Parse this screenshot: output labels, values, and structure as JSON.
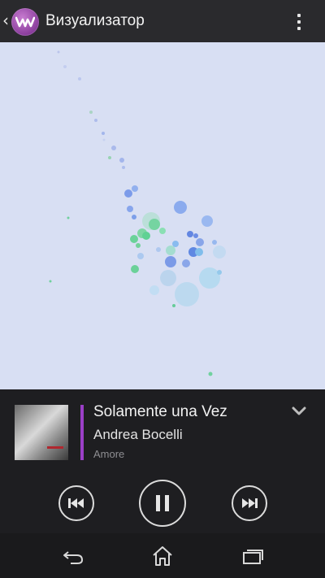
{
  "app": {
    "title": "Визуализатор",
    "icons": {
      "back": "chevron-left-icon",
      "logo": "walkman-logo-icon",
      "menu": "overflow-menu-icon"
    }
  },
  "now_playing": {
    "song": "Solamente una Vez",
    "artist": "Andrea Bocelli",
    "album": "Amore",
    "accent_color": "#9b3fc7"
  },
  "controls": {
    "previous_icon": "skip-previous-icon",
    "pause_icon": "pause-icon",
    "next_icon": "skip-next-icon",
    "collapse_icon": "chevron-down-icon"
  },
  "system_nav": {
    "back_icon": "back-arrow-icon",
    "home_icon": "home-icon",
    "recents_icon": "recent-apps-icon"
  },
  "colors": {
    "visualizer_bg": "#d8dff3",
    "bubble_blue": "#5b86e6",
    "bubble_green": "#57d08a"
  }
}
